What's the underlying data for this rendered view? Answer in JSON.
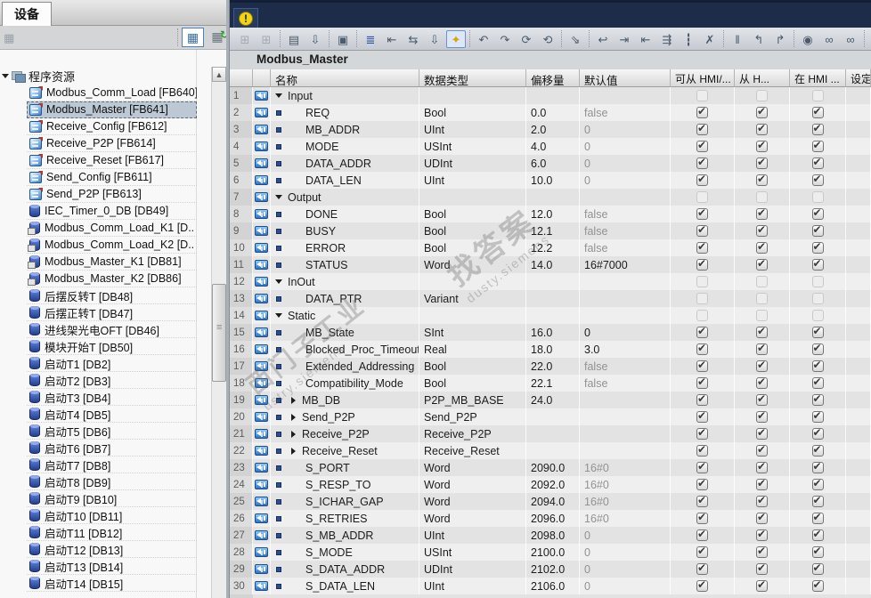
{
  "sidebar": {
    "tab_label": "设备",
    "toolbar": {
      "options_icon": "▦",
      "detail_view_icon": "▦",
      "refresh_view_icon": "▦",
      "refresh_arrow": "↻"
    },
    "tree_root": "程序资源",
    "items": [
      {
        "label": "Modbus_Comm_Load [FB640]",
        "icon": "fb",
        "selected": false
      },
      {
        "label": "Modbus_Master [FB641]",
        "icon": "fb",
        "selected": true
      },
      {
        "label": "Receive_Config [FB612]",
        "icon": "fb",
        "selected": false
      },
      {
        "label": "Receive_P2P [FB614]",
        "icon": "fb",
        "selected": false
      },
      {
        "label": "Receive_Reset [FB617]",
        "icon": "fb",
        "selected": false
      },
      {
        "label": "Send_Config [FB611]",
        "icon": "fb",
        "selected": false
      },
      {
        "label": "Send_P2P [FB613]",
        "icon": "fb",
        "selected": false
      },
      {
        "label": "IEC_Timer_0_DB [DB49]",
        "icon": "db",
        "selected": false
      },
      {
        "label": "Modbus_Comm_Load_K1 [D..",
        "icon": "dbl",
        "selected": false
      },
      {
        "label": "Modbus_Comm_Load_K2 [D..",
        "icon": "dbl",
        "selected": false
      },
      {
        "label": "Modbus_Master_K1 [DB81]",
        "icon": "dbl",
        "selected": false
      },
      {
        "label": "Modbus_Master_K2 [DB86]",
        "icon": "dbl",
        "selected": false
      },
      {
        "label": "后摆反转T [DB48]",
        "icon": "db",
        "selected": false
      },
      {
        "label": "后摆正转T [DB47]",
        "icon": "db",
        "selected": false
      },
      {
        "label": "进线架光电OFT [DB46]",
        "icon": "db",
        "selected": false
      },
      {
        "label": "模块开始T [DB50]",
        "icon": "db",
        "selected": false
      },
      {
        "label": "启动T1 [DB2]",
        "icon": "db",
        "selected": false
      },
      {
        "label": "启动T2 [DB3]",
        "icon": "db",
        "selected": false
      },
      {
        "label": "启动T3 [DB4]",
        "icon": "db",
        "selected": false
      },
      {
        "label": "启动T4 [DB5]",
        "icon": "db",
        "selected": false
      },
      {
        "label": "启动T5 [DB6]",
        "icon": "db",
        "selected": false
      },
      {
        "label": "启动T6 [DB7]",
        "icon": "db",
        "selected": false
      },
      {
        "label": "启动T7 [DB8]",
        "icon": "db",
        "selected": false
      },
      {
        "label": "启动T8 [DB9]",
        "icon": "db",
        "selected": false
      },
      {
        "label": "启动T9 [DB10]",
        "icon": "db",
        "selected": false
      },
      {
        "label": "启动T10 [DB11]",
        "icon": "db",
        "selected": false
      },
      {
        "label": "启动T11 [DB12]",
        "icon": "db",
        "selected": false
      },
      {
        "label": "启动T12 [DB13]",
        "icon": "db",
        "selected": false
      },
      {
        "label": "启动T13 [DB14]",
        "icon": "db",
        "selected": false
      },
      {
        "label": "启动T14 [DB15]",
        "icon": "db",
        "selected": false
      }
    ]
  },
  "main": {
    "alert": {
      "glyph": "!",
      "color": "#f2d410"
    },
    "toolbar_icons": [
      {
        "name": "insert-row",
        "glyph": "⊞",
        "state": "disabled"
      },
      {
        "name": "add-row",
        "glyph": "⊞",
        "state": "disabled"
      },
      {
        "sep": true
      },
      {
        "name": "open-external-source",
        "glyph": "▤",
        "state": "normal"
      },
      {
        "name": "download-to-device",
        "glyph": "⇩",
        "state": "normal"
      },
      {
        "sep": true
      },
      {
        "name": "keep-actual-values",
        "glyph": "▣",
        "state": "normal"
      },
      {
        "sep": true
      },
      {
        "name": "snapshot-actual-values",
        "glyph": "≣",
        "state": "accent"
      },
      {
        "name": "copy-snapshot-to-start",
        "glyph": "⇤",
        "state": "normal"
      },
      {
        "name": "copy-start-to-snapshot",
        "glyph": "⇆",
        "state": "normal"
      },
      {
        "name": "load-start-values",
        "glyph": "⇩",
        "state": "normal"
      },
      {
        "name": "expanded-mode",
        "glyph": "✦",
        "state": "active"
      },
      {
        "sep": true
      },
      {
        "name": "reset-start-values",
        "glyph": "↶",
        "state": "normal"
      },
      {
        "name": "update-interface",
        "glyph": "↷",
        "state": "normal"
      },
      {
        "name": "refresh-block",
        "glyph": "⟳",
        "state": "normal"
      },
      {
        "name": "synchronize-block",
        "glyph": "⟲",
        "state": "normal"
      },
      {
        "sep": true
      },
      {
        "name": "sort-order",
        "glyph": "⇘",
        "state": "normal"
      },
      {
        "sep": true
      },
      {
        "name": "jump-to-definition",
        "glyph": "↩",
        "state": "normal"
      },
      {
        "name": "indent-row",
        "glyph": "⇥",
        "state": "normal"
      },
      {
        "name": "outdent-row",
        "glyph": "⇤",
        "state": "normal"
      },
      {
        "name": "merge-rows",
        "glyph": "⇶",
        "state": "normal"
      },
      {
        "name": "insert-separator-line",
        "glyph": "┇",
        "state": "normal"
      },
      {
        "name": "delete-row",
        "glyph": "✗",
        "state": "normal"
      },
      {
        "sep": true
      },
      {
        "name": "pause-monitoring",
        "glyph": "‖",
        "state": "normal"
      },
      {
        "name": "jump-back",
        "glyph": "↰",
        "state": "normal"
      },
      {
        "name": "jump-forward",
        "glyph": "↱",
        "state": "normal"
      },
      {
        "sep": true
      },
      {
        "name": "find-in-block",
        "glyph": "◉",
        "state": "normal"
      },
      {
        "name": "monitor-all",
        "glyph": "∞",
        "state": "normal"
      },
      {
        "name": "monitor-stop",
        "glyph": "∞",
        "state": "normal"
      },
      {
        "sep": true
      },
      {
        "name": "know-how-protection",
        "glyph": "▣",
        "state": "normal"
      }
    ],
    "title": "Modbus_Master",
    "table": {
      "columns": [
        "",
        "",
        "名称",
        "数据类型",
        "偏移量",
        "默认值",
        "可从 HMI/...",
        "从 H...",
        "在 HMI ...",
        "设定"
      ],
      "rows": [
        {
          "num": "1",
          "kind": "section",
          "name": "Input",
          "type": "",
          "offset": "",
          "default": "",
          "emph": false,
          "cb": "d"
        },
        {
          "num": "2",
          "kind": "member",
          "name": "REQ",
          "type": "Bool",
          "offset": "0.0",
          "default": "false",
          "emph": false,
          "cb": "c"
        },
        {
          "num": "3",
          "kind": "member",
          "name": "MB_ADDR",
          "type": "UInt",
          "offset": "2.0",
          "default": "0",
          "emph": false,
          "cb": "c"
        },
        {
          "num": "4",
          "kind": "member",
          "name": "MODE",
          "type": "USInt",
          "offset": "4.0",
          "default": "0",
          "emph": false,
          "cb": "c"
        },
        {
          "num": "5",
          "kind": "member",
          "name": "DATA_ADDR",
          "type": "UDInt",
          "offset": "6.0",
          "default": "0",
          "emph": false,
          "cb": "c"
        },
        {
          "num": "6",
          "kind": "member",
          "name": "DATA_LEN",
          "type": "UInt",
          "offset": "10.0",
          "default": "0",
          "emph": false,
          "cb": "c"
        },
        {
          "num": "7",
          "kind": "section",
          "name": "Output",
          "type": "",
          "offset": "",
          "default": "",
          "emph": false,
          "cb": "d"
        },
        {
          "num": "8",
          "kind": "member",
          "name": "DONE",
          "type": "Bool",
          "offset": "12.0",
          "default": "false",
          "emph": false,
          "cb": "c"
        },
        {
          "num": "9",
          "kind": "member",
          "name": "BUSY",
          "type": "Bool",
          "offset": "12.1",
          "default": "false",
          "emph": false,
          "cb": "c"
        },
        {
          "num": "10",
          "kind": "member",
          "name": "ERROR",
          "type": "Bool",
          "offset": "12.2",
          "default": "false",
          "emph": false,
          "cb": "c"
        },
        {
          "num": "11",
          "kind": "member",
          "name": "STATUS",
          "type": "Word",
          "offset": "14.0",
          "default": "16#7000",
          "emph": true,
          "cb": "c"
        },
        {
          "num": "12",
          "kind": "section",
          "name": "InOut",
          "type": "",
          "offset": "",
          "default": "",
          "emph": false,
          "cb": "d"
        },
        {
          "num": "13",
          "kind": "member",
          "name": "DATA_PTR",
          "type": "Variant",
          "offset": "",
          "default": "",
          "emph": false,
          "cb": "d"
        },
        {
          "num": "14",
          "kind": "section",
          "name": "Static",
          "type": "",
          "offset": "",
          "default": "",
          "emph": false,
          "cb": "d"
        },
        {
          "num": "15",
          "kind": "member",
          "name": "MB_State",
          "type": "SInt",
          "offset": "16.0",
          "default": "0",
          "emph": true,
          "cb": "c"
        },
        {
          "num": "16",
          "kind": "member",
          "name": "Blocked_Proc_Timeout",
          "type": "Real",
          "offset": "18.0",
          "default": "3.0",
          "emph": true,
          "cb": "c"
        },
        {
          "num": "17",
          "kind": "member",
          "name": "Extended_Addressing",
          "type": "Bool",
          "offset": "22.0",
          "default": "false",
          "emph": false,
          "cb": "c"
        },
        {
          "num": "18",
          "kind": "member",
          "name": "Compatibility_Mode",
          "type": "Bool",
          "offset": "22.1",
          "default": "false",
          "emph": false,
          "cb": "c"
        },
        {
          "num": "19",
          "kind": "expandable",
          "name": "MB_DB",
          "type": "P2P_MB_BASE",
          "offset": "24.0",
          "default": "",
          "emph": false,
          "cb": "c"
        },
        {
          "num": "20",
          "kind": "expandable",
          "name": "Send_P2P",
          "type": "Send_P2P",
          "offset": "",
          "default": "",
          "emph": false,
          "cb": "c"
        },
        {
          "num": "21",
          "kind": "expandable",
          "name": "Receive_P2P",
          "type": "Receive_P2P",
          "offset": "",
          "default": "",
          "emph": false,
          "cb": "c"
        },
        {
          "num": "22",
          "kind": "expandable",
          "name": "Receive_Reset",
          "type": "Receive_Reset",
          "offset": "",
          "default": "",
          "emph": false,
          "cb": "c"
        },
        {
          "num": "23",
          "kind": "member",
          "name": "S_PORT",
          "type": "Word",
          "offset": "2090.0",
          "default": "16#0",
          "emph": false,
          "cb": "c"
        },
        {
          "num": "24",
          "kind": "member",
          "name": "S_RESP_TO",
          "type": "Word",
          "offset": "2092.0",
          "default": "16#0",
          "emph": false,
          "cb": "c"
        },
        {
          "num": "25",
          "kind": "member",
          "name": "S_ICHAR_GAP",
          "type": "Word",
          "offset": "2094.0",
          "default": "16#0",
          "emph": false,
          "cb": "c"
        },
        {
          "num": "26",
          "kind": "member",
          "name": "S_RETRIES",
          "type": "Word",
          "offset": "2096.0",
          "default": "16#0",
          "emph": false,
          "cb": "c"
        },
        {
          "num": "27",
          "kind": "member",
          "name": "S_MB_ADDR",
          "type": "UInt",
          "offset": "2098.0",
          "default": "0",
          "emph": false,
          "cb": "c"
        },
        {
          "num": "28",
          "kind": "member",
          "name": "S_MODE",
          "type": "USInt",
          "offset": "2100.0",
          "default": "0",
          "emph": false,
          "cb": "c"
        },
        {
          "num": "29",
          "kind": "member",
          "name": "S_DATA_ADDR",
          "type": "UDInt",
          "offset": "2102.0",
          "default": "0",
          "emph": false,
          "cb": "c"
        },
        {
          "num": "30",
          "kind": "member",
          "name": "S_DATA_LEN",
          "type": "UInt",
          "offset": "2106.0",
          "default": "0",
          "emph": false,
          "cb": "c"
        }
      ]
    },
    "watermarks": [
      {
        "text": "找答案",
        "sub": "dusty.siemens"
      },
      {
        "text": "西门子工业",
        "sub": "ustry.siemens"
      }
    ],
    "colors": {
      "band": "#1d2c49",
      "alert_yellow": "#f2d410",
      "accent_blue": "#2b53a8",
      "star_gold": "#d9a400"
    }
  }
}
